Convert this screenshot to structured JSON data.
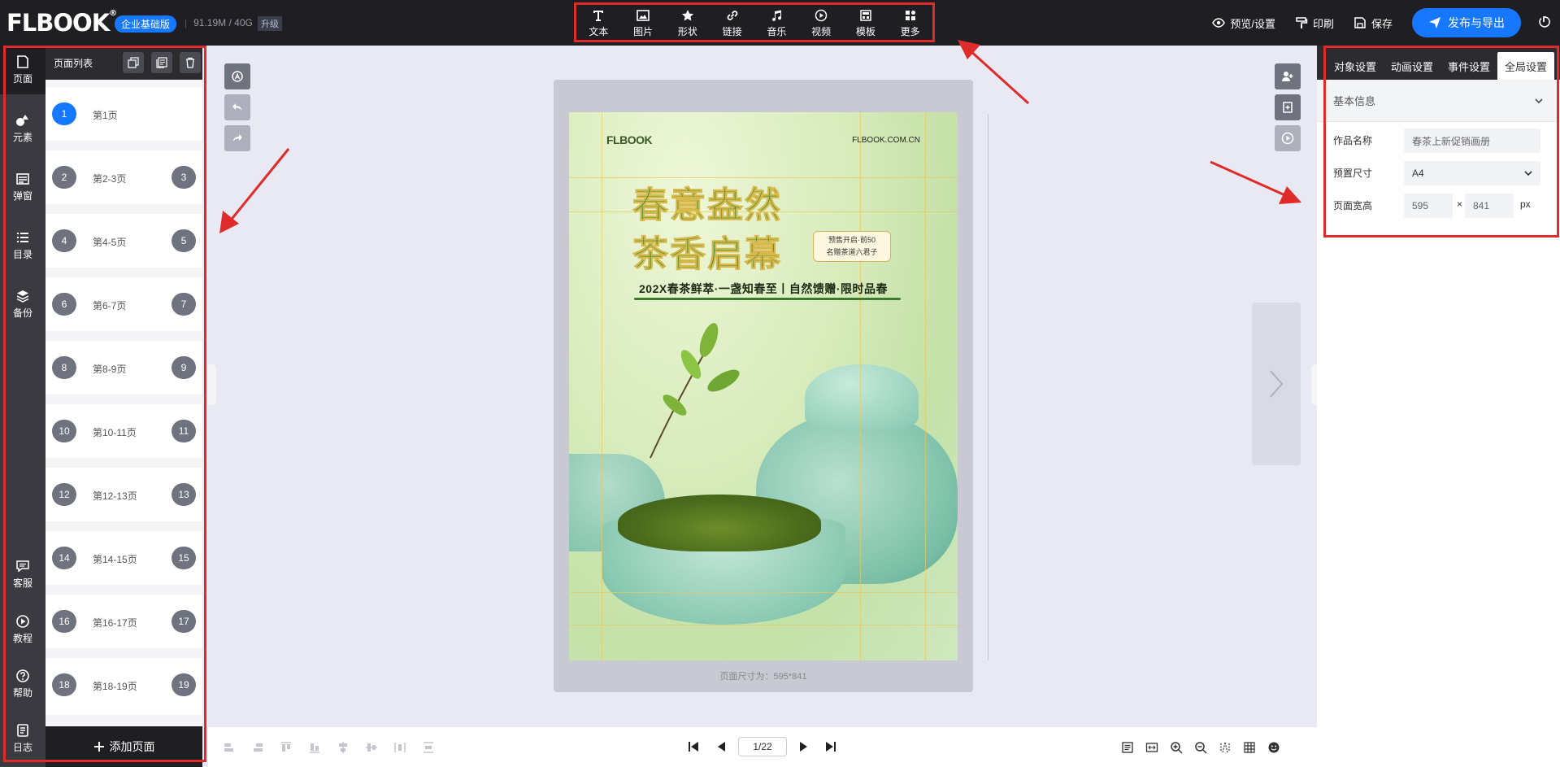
{
  "header": {
    "logo": "FLBOOK",
    "logo_mark": "®",
    "edition": "企业基础版",
    "storage": "91.19M / 40G",
    "upgrade": "升级",
    "tools": [
      {
        "label": "文本",
        "icon": "text-icon"
      },
      {
        "label": "图片",
        "icon": "image-icon"
      },
      {
        "label": "形状",
        "icon": "star-icon"
      },
      {
        "label": "链接",
        "icon": "link-icon"
      },
      {
        "label": "音乐",
        "icon": "music-icon"
      },
      {
        "label": "视频",
        "icon": "video-icon"
      },
      {
        "label": "模板",
        "icon": "template-icon"
      },
      {
        "label": "更多",
        "icon": "more-icon"
      }
    ],
    "preview": "预览/设置",
    "print": "印刷",
    "save": "保存",
    "publish": "发布与导出"
  },
  "rail": {
    "top": [
      {
        "label": "页面",
        "icon": "page-icon"
      },
      {
        "label": "元素",
        "icon": "elements-icon"
      },
      {
        "label": "弹窗",
        "icon": "popup-icon"
      },
      {
        "label": "目录",
        "icon": "toc-icon"
      },
      {
        "label": "备份",
        "icon": "backup-icon"
      }
    ],
    "bottom": [
      {
        "label": "客服",
        "icon": "chat-icon"
      },
      {
        "label": "教程",
        "icon": "play-circle-icon"
      },
      {
        "label": "帮助",
        "icon": "help-icon"
      },
      {
        "label": "日志",
        "icon": "log-icon"
      }
    ]
  },
  "pagelist": {
    "title": "页面列表",
    "rows": [
      {
        "left": "1",
        "label": "第1页",
        "right": ""
      },
      {
        "left": "2",
        "label": "第2-3页",
        "right": "3"
      },
      {
        "left": "4",
        "label": "第4-5页",
        "right": "5"
      },
      {
        "left": "6",
        "label": "第6-7页",
        "right": "7"
      },
      {
        "left": "8",
        "label": "第8-9页",
        "right": "9"
      },
      {
        "left": "10",
        "label": "第10-11页",
        "right": "11"
      },
      {
        "left": "12",
        "label": "第12-13页",
        "right": "13"
      },
      {
        "left": "14",
        "label": "第14-15页",
        "right": "15"
      },
      {
        "left": "16",
        "label": "第16-17页",
        "right": "17"
      },
      {
        "left": "18",
        "label": "第18-19页",
        "right": "19"
      }
    ],
    "add": "添加页面"
  },
  "poster": {
    "brand": "FLBOOK",
    "site": "FLBOOK.COM.CN",
    "title1": "春意盎然",
    "title2": "茶香启幕",
    "badge1": "预售开启·前50",
    "badge2": "名赠茶道六君子",
    "subtitle": "202X春茶鲜萃·一盏知春至丨自然馈赠·限时品春"
  },
  "canvas": {
    "page_size": "页面尺寸为：595*841"
  },
  "rpanel": {
    "tabs": [
      "对象设置",
      "动画设置",
      "事件设置",
      "全局设置"
    ],
    "section": "基本信息",
    "name_label": "作品名称",
    "name_placeholder": "春茶上新促销画册",
    "size_label": "预置尺寸",
    "size_value": "A4",
    "wh_label": "页面宽高",
    "width": "595",
    "times": "×",
    "height": "841",
    "unit": "px"
  },
  "bottom": {
    "page_indicator": "1/22"
  },
  "colors": {
    "accent": "#1677ff",
    "dark": "#1f1f23",
    "highlight": "#e02b2b"
  }
}
